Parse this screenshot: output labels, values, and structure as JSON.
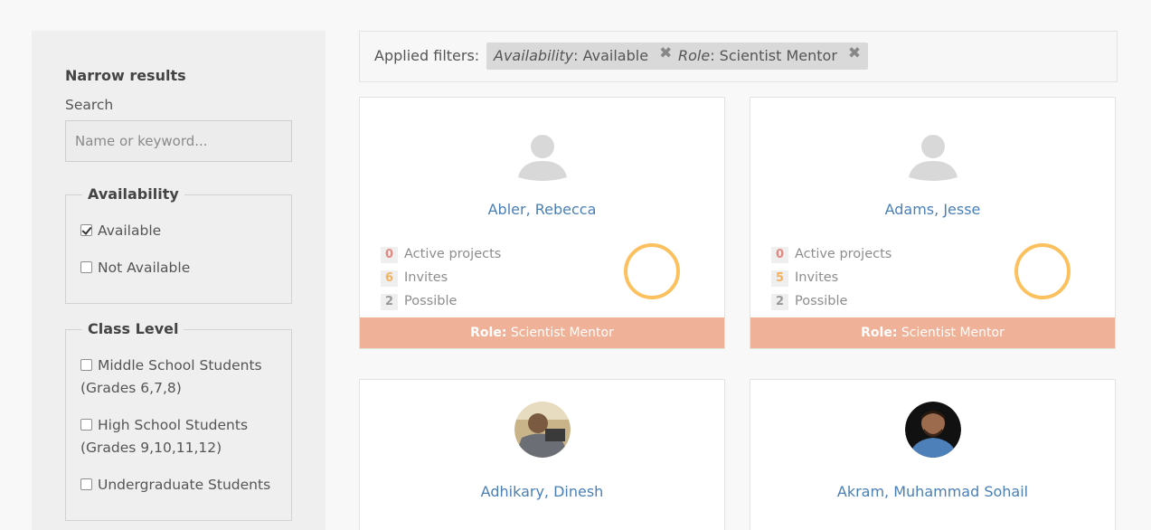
{
  "sidebar": {
    "title": "Narrow results",
    "search_label": "Search",
    "search_placeholder": "Name or keyword...",
    "availability": {
      "legend": "Availability",
      "options": [
        {
          "label": "Available",
          "checked": true
        },
        {
          "label": "Not Available",
          "checked": false
        }
      ]
    },
    "class_level": {
      "legend": "Class Level",
      "options": [
        {
          "label": "Middle School Students (Grades 6,7,8)",
          "checked": false
        },
        {
          "label": "High School Students (Grades 9,10,11,12)",
          "checked": false
        },
        {
          "label": "Undergraduate Students",
          "checked": false
        }
      ]
    }
  },
  "filters": {
    "label": "Applied filters:",
    "chips": [
      {
        "key": "Availability",
        "value": ": Available",
        "remove": "✖"
      },
      {
        "key": "Role",
        "value": ": Scientist Mentor",
        "remove": "✖"
      }
    ]
  },
  "stat_labels": {
    "active": "Active projects",
    "invites": "Invites",
    "possible": "Possible"
  },
  "role_prefix": "Role:",
  "cards": [
    {
      "name": "Abler, Rebecca",
      "active": "0",
      "invites": "6",
      "possible": "2",
      "role": " Scientist Mentor"
    },
    {
      "name": "Adams, Jesse",
      "active": "0",
      "invites": "5",
      "possible": "2",
      "role": " Scientist Mentor"
    },
    {
      "name": "Adhikary, Dinesh"
    },
    {
      "name": "Akram, Muhammad Sohail"
    }
  ],
  "colors": {
    "link": "#4a7fb5",
    "role_bar": "#efb197",
    "ring": "#fcc15e",
    "active_num": "#e08a80",
    "invites_num": "#f2b35f"
  }
}
